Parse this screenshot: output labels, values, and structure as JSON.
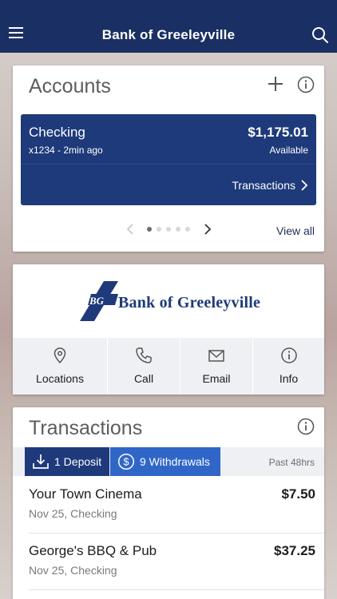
{
  "header": {
    "title": "Bank of Greeleyville",
    "menu_icon": "hamburger-icon",
    "search_icon": "search-icon"
  },
  "accounts": {
    "title": "Accounts",
    "add_icon": "plus-icon",
    "info_icon": "info-icon",
    "account": {
      "name": "Checking",
      "number_age": "x1234 - 2min ago",
      "balance": "$1,175.01",
      "balance_label": "Available",
      "transactions_label": "Transactions"
    },
    "pager": {
      "total": 5,
      "current": 1
    },
    "view_all": "View all"
  },
  "bank": {
    "logo_monogram": "BG",
    "logo_text": "Bank of Greeleyville",
    "actions": [
      {
        "label": "Locations",
        "icon": "map-pin-icon"
      },
      {
        "label": "Call",
        "icon": "phone-icon"
      },
      {
        "label": "Email",
        "icon": "envelope-icon"
      },
      {
        "label": "Info",
        "icon": "info-icon"
      }
    ]
  },
  "transactions": {
    "title": "Transactions",
    "info_icon": "info-icon",
    "deposit_label": "1 Deposit",
    "withdrawal_label": "9 Withdrawals",
    "range_label": "Past 48hrs",
    "items": [
      {
        "merchant": "Your Town Cinema",
        "amount": "$7.50",
        "detail": "Nov 25, Checking"
      },
      {
        "merchant": "George's BBQ & Pub",
        "amount": "$37.25",
        "detail": "Nov 25, Checking"
      }
    ]
  },
  "colors": {
    "navy": "#1a2f63",
    "panel_blue": "#1e3a7a",
    "bright_blue": "#2f66c8",
    "action_bg": "#eef0f4"
  }
}
